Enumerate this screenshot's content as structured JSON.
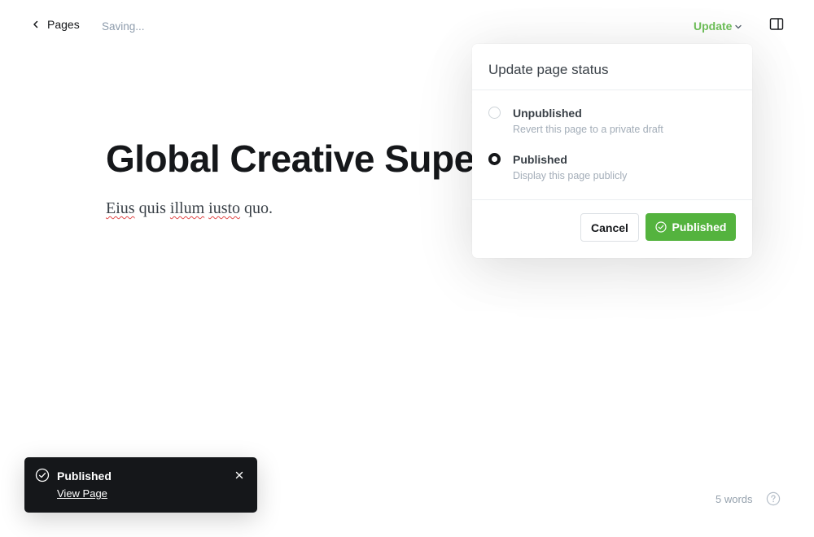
{
  "topbar": {
    "back_label": "Pages",
    "saving_status": "Saving...",
    "update_label": "Update",
    "icons": {
      "back": "chevron-left-icon",
      "update_dropdown": "chevron-down-icon",
      "sidebar": "sidebar-toggle-icon"
    }
  },
  "editor": {
    "title": "Global Creative Supe",
    "body_words": [
      "Eius",
      "quis",
      "illum",
      "iusto",
      "quo."
    ]
  },
  "popover": {
    "heading": "Update page status",
    "options": [
      {
        "label": "Unpublished",
        "description": "Revert this page to a private draft",
        "selected": false
      },
      {
        "label": "Published",
        "description": "Display this page publicly",
        "selected": true
      }
    ],
    "cancel_label": "Cancel",
    "confirm_label": "Published"
  },
  "toast": {
    "title": "Published",
    "link_label": "View Page",
    "icon": "check-circle-icon"
  },
  "footer": {
    "word_count": "5 words",
    "help_icon": "help-circle-icon"
  },
  "colors": {
    "accent_green": "#54b33e",
    "update_green": "#6fc15a",
    "toast_bg": "#15171a",
    "muted_text": "#8e9cac"
  }
}
